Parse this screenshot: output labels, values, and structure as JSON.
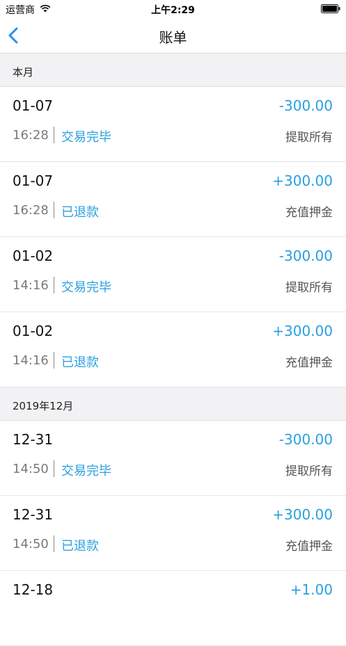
{
  "status_bar": {
    "carrier": "运营商",
    "time": "上午2:29"
  },
  "nav": {
    "title": "账单",
    "back_icon": "chevron-left-icon"
  },
  "colors": {
    "accent": "#2a9fe0",
    "section_bg": "#f2f2f4"
  },
  "sections": [
    {
      "header": "本月",
      "rows": [
        {
          "date": "01-07",
          "amount": "-300.00",
          "time": "16:28",
          "status": "交易完毕",
          "type": "提取所有"
        },
        {
          "date": "01-07",
          "amount": "+300.00",
          "time": "16:28",
          "status": "已退款",
          "type": "充值押金"
        },
        {
          "date": "01-02",
          "amount": "-300.00",
          "time": "14:16",
          "status": "交易完毕",
          "type": "提取所有"
        },
        {
          "date": "01-02",
          "amount": "+300.00",
          "time": "14:16",
          "status": "已退款",
          "type": "充值押金"
        }
      ]
    },
    {
      "header": "2019年12月",
      "rows": [
        {
          "date": "12-31",
          "amount": "-300.00",
          "time": "14:50",
          "status": "交易完毕",
          "type": "提取所有"
        },
        {
          "date": "12-31",
          "amount": "+300.00",
          "time": "14:50",
          "status": "已退款",
          "type": "充值押金"
        },
        {
          "date": "12-18",
          "amount": "+1.00",
          "time": "",
          "status": "",
          "type": ""
        }
      ]
    }
  ]
}
